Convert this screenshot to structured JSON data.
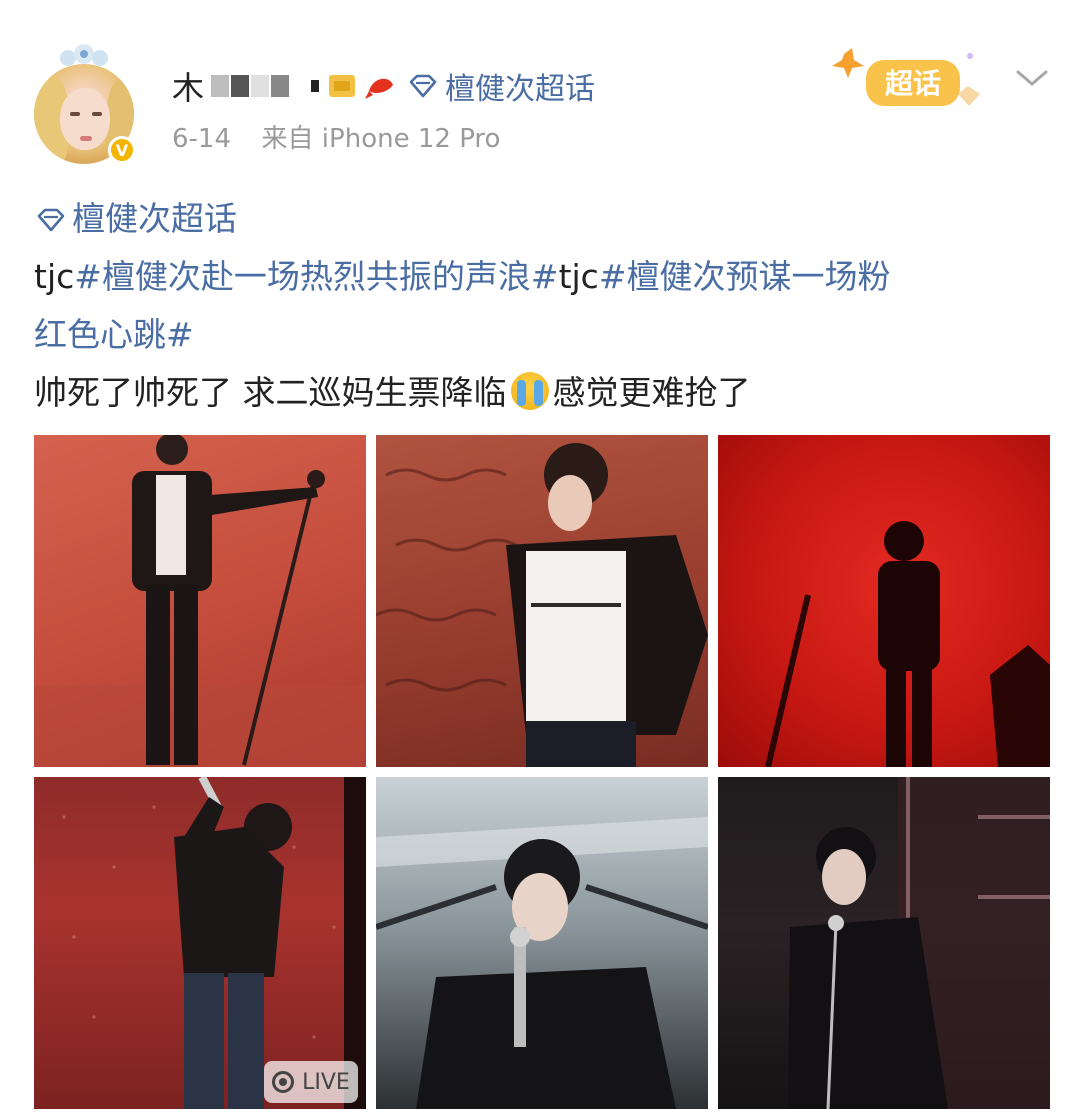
{
  "post": {
    "username": "木",
    "super_topic": "檀健次超话",
    "date": "6-14",
    "source": "来自 iPhone 12 Pro",
    "super_badge_label": "超话"
  },
  "content": {
    "topic_link": "檀健次超话",
    "line2": [
      {
        "type": "plain",
        "text": "tjc"
      },
      {
        "type": "link",
        "text": "#檀健次赴一场热烈共振的声浪#"
      },
      {
        "type": "plain",
        "text": "tjc"
      },
      {
        "type": "link",
        "text": "#檀健次预谋一场粉"
      }
    ],
    "line3": "红色心跳#",
    "line4_part1": "帅死了帅死了 求二巡妈生票降临",
    "line4_part2": "感觉更难抢了"
  },
  "images": {
    "live_label": "LIVE",
    "count": 6
  },
  "colors": {
    "link": "#4a6ea3",
    "meta": "#9a9a9a",
    "verified": "#f4b400"
  }
}
